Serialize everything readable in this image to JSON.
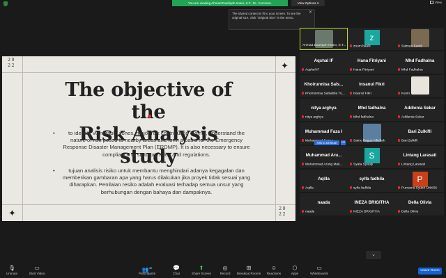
{
  "topbar": {
    "viewing_text": "You are viewing Ahmad Daufiqah Imani, S.T., M...'s screen.",
    "view_options": "View Options ▾",
    "view_button": "View"
  },
  "tooltip": {
    "text": "The shared content is fit to your screen. To see the original size, click \"Original Size\" in the menu.",
    "close": "✕"
  },
  "slide": {
    "year_top": "20\n22",
    "year_bottom": "20\n22",
    "title_line1": "The objective of the",
    "title_line2": "Risk Analysis study",
    "bullet1": "to identify vulnerable zones, major risk contributing events, understand the nature of risk posed to nearby areas and form a basis for the Emergency Response Disaster Management Plan (ERDMP). It is also necessary to ensure compliance to statutory rules and regulations.",
    "bullet2": "tujuan analisis risiko untuk membantu  menghindari adanya kegagalan dan  memberikan gambaran apa yang harus dilakukan jika proyek tidak sesuai yang diharapkan. Penilaian resiko adalah evaluasi terhadap semua unsur yang berhubungan dengan bahaya dan dampaknya.",
    "bullet_char": "•",
    "sparkle": "✦"
  },
  "participants": [
    {
      "big": "",
      "name": "Ahmad Daufiqah Imani, S.T...",
      "muted": false,
      "kind": "photo",
      "color": "#6a7a6a"
    },
    {
      "big": "",
      "name": "zoom baal4",
      "muted": true,
      "kind": "avatar",
      "letter": "z",
      "color": "#1aa7a0"
    },
    {
      "big": "",
      "name": "Salman Kamil",
      "muted": true,
      "kind": "photo",
      "color": "#7a6a52"
    },
    {
      "big": "Aqshal IF",
      "name": "Aqshal IF",
      "muted": true
    },
    {
      "big": "Hana Fitriyani",
      "name": "Hana Fitriyani",
      "muted": true
    },
    {
      "big": "Mhd Fadhalna",
      "name": "Mhd Fadhalna",
      "muted": true
    },
    {
      "big": "Khoirunnisa Sals...",
      "name": "Khoirunnisa Salsabila Tu...",
      "muted": true
    },
    {
      "big": "Insanul Fikri",
      "name": "Insanul Fikri",
      "muted": true
    },
    {
      "big": "",
      "name": "Kevin",
      "muted": true,
      "kind": "photo",
      "color": "#e8e4dc"
    },
    {
      "big": "nitya arghya",
      "name": "nitya arghya",
      "muted": true
    },
    {
      "big": "Mhd fadhalna",
      "name": "Mhd fadhalna",
      "muted": true
    },
    {
      "big": "Addienia Sekar",
      "name": "Addienia Sekar",
      "muted": true
    },
    {
      "big": "Muhammad Faza I",
      "name": "Muhammad Faza I",
      "muted": true
    },
    {
      "big": "",
      "name": "Satrio Bagus Affiellah",
      "muted": true,
      "kind": "photo",
      "color": "#5c7fa0"
    },
    {
      "big": "Bari Zulkifli",
      "name": "Bari Zulkifli",
      "muted": true
    },
    {
      "big": "Muhammad  Aru...",
      "name": "Muhammad Arung Mak...",
      "muted": true
    },
    {
      "big": "",
      "name": "Syafa Syauqi",
      "muted": true,
      "kind": "avatar",
      "letter": "S",
      "color": "#1aa7a0"
    },
    {
      "big": "Lintang Larasati",
      "name": "Lintang Larasati",
      "muted": true
    },
    {
      "big": "Aqilla",
      "name": "Aqilla",
      "muted": true
    },
    {
      "big": "syifa fadhila",
      "name": "syifa fadhila",
      "muted": true
    },
    {
      "big": "",
      "name": "Purnama Syukri UNK56",
      "muted": true,
      "kind": "avatar",
      "letter": "P",
      "color": "#c8401c"
    },
    {
      "big": "naada",
      "name": "naada",
      "muted": true
    },
    {
      "big": "INEZA BRIGITHA",
      "name": "INEZA BRIGITHA",
      "muted": true
    },
    {
      "big": "Della Olivia",
      "name": "Della Olivia",
      "muted": true
    }
  ],
  "ask_to_unmute": "Ask to Unmute",
  "ask_more": "•••",
  "pager": "⌄",
  "toolbar": {
    "unmute": "Unmute",
    "start_video": "Start Video",
    "participants": "Participants",
    "participants_count": "42",
    "chat": "Chat",
    "share_screen": "Share Screen",
    "record": "Record",
    "breakout": "Breakout Rooms",
    "reactions": "Reactions",
    "apps": "Apps",
    "whiteboards": "Whiteboards",
    "leave": "Leave Room"
  }
}
